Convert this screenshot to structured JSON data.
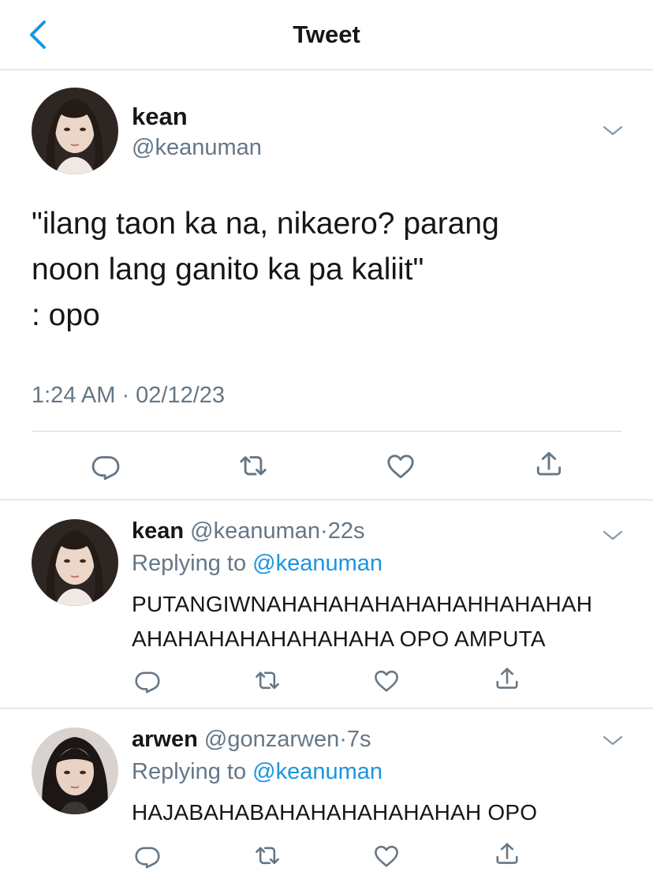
{
  "header": {
    "title": "Tweet"
  },
  "colors": {
    "accent": "#1b95e0",
    "secondary_text": "#657786",
    "divider": "#d3d6d9"
  },
  "main_tweet": {
    "name": "kean",
    "handle": "@keanuman",
    "text": "\"ilang taon ka na, nikaero? parang\nnoon lang ganito ka pa kaliit\"\n: opo",
    "timestamp": "1:24 AM · 02/12/23"
  },
  "replies": [
    {
      "name": "kean",
      "handle": "@keanuman",
      "sep": "·",
      "time": "22s",
      "replying_label": "Replying to ",
      "replying_handle": "@keanuman",
      "text": "PUTANGIWNAHAHAHAHAHAHAHHAHAHAH\nAHAHAHAHAHAHAHAHA OPO AMPUTA"
    },
    {
      "name": "arwen",
      "handle": "@gonzarwen",
      "sep": "·",
      "time": "7s",
      "replying_label": "Replying to ",
      "replying_handle": "@keanuman",
      "text": "HAJABAHABAHAHAHAHAHAHAH OPO"
    }
  ],
  "icons": [
    "back-chevron-icon",
    "chevron-down-icon",
    "reply-icon",
    "retweet-icon",
    "like-icon",
    "share-icon"
  ]
}
